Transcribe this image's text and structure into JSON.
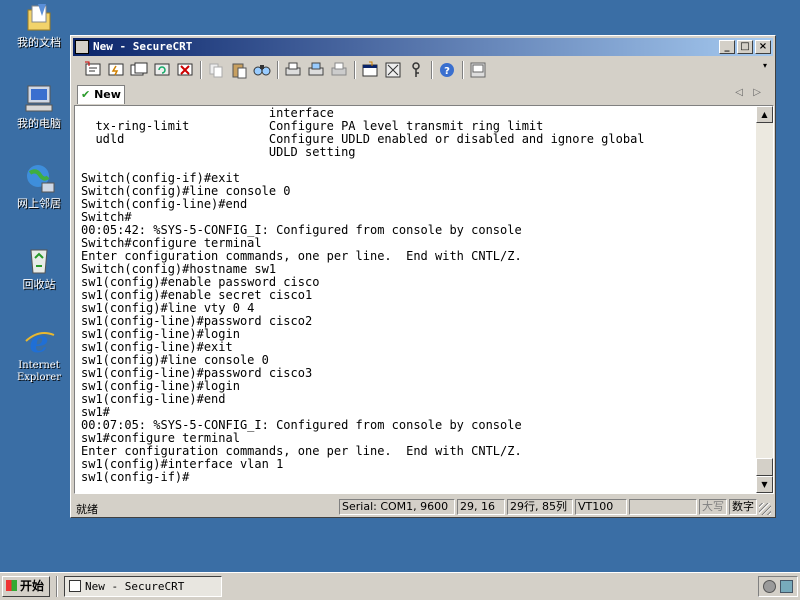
{
  "desktop": {
    "icons": [
      {
        "label": "我的文档",
        "icon": "my-documents-icon"
      },
      {
        "label": "我的电脑",
        "icon": "my-computer-icon"
      },
      {
        "label": "网上邻居",
        "icon": "network-neighborhood-icon"
      },
      {
        "label": "回收站",
        "icon": "recycle-bin-icon"
      },
      {
        "label": "Internet Explorer",
        "icon": "internet-explorer-icon"
      }
    ]
  },
  "window": {
    "title": "New - SecureCRT",
    "minimize": "_",
    "maximize": "□",
    "close": "×"
  },
  "toolbar": {
    "buttons": [
      "connect-icon",
      "quick-connect-icon",
      "connect-in-tab-icon",
      "reconnect-icon",
      "disconnect-icon",
      "copy-icon",
      "paste-icon",
      "find-icon",
      "print-icon",
      "print-selection-icon",
      "print-setup-icon",
      "session-options-icon",
      "global-options-icon",
      "keymap-icon",
      "help-icon",
      "log-icon"
    ]
  },
  "tabs": [
    {
      "label": "New",
      "status_icon": "check-icon"
    }
  ],
  "terminal": {
    "lines": [
      "                          interface",
      "  tx-ring-limit           Configure PA level transmit ring limit",
      "  udld                    Configure UDLD enabled or disabled and ignore global",
      "                          UDLD setting",
      "",
      "Switch(config-if)#exit",
      "Switch(config)#line console 0",
      "Switch(config-line)#end",
      "Switch#",
      "00:05:42: %SYS-5-CONFIG_I: Configured from console by console",
      "Switch#configure terminal",
      "Enter configuration commands, one per line.  End with CNTL/Z.",
      "Switch(config)#hostname sw1",
      "sw1(config)#enable password cisco",
      "sw1(config)#enable secret cisco1",
      "sw1(config)#line vty 0 4",
      "sw1(config-line)#password cisco2",
      "sw1(config-line)#login",
      "sw1(config-line)#exit",
      "sw1(config)#line console 0",
      "sw1(config-line)#password cisco3",
      "sw1(config-line)#login",
      "sw1(config-line)#end",
      "sw1#",
      "00:07:05: %SYS-5-CONFIG_I: Configured from console by console",
      "sw1#configure terminal",
      "Enter configuration commands, one per line.  End with CNTL/Z.",
      "sw1(config)#interface vlan 1",
      "sw1(config-if)#"
    ]
  },
  "statusbar": {
    "ready": "就绪",
    "serial": "Serial: COM1, 9600",
    "cursor": "29, 16",
    "rows_cols": "29行, 85列",
    "emulation": "VT100",
    "blank": "",
    "caps": "大写",
    "num": "数字"
  },
  "taskbar": {
    "start": "开始",
    "task_title": "New - SecureCRT"
  },
  "colors": {
    "desktop": "#3a6ea5",
    "titlebar_start": "#0a246a",
    "titlebar_end": "#a6caf0",
    "chrome": "#d4d0c8"
  }
}
